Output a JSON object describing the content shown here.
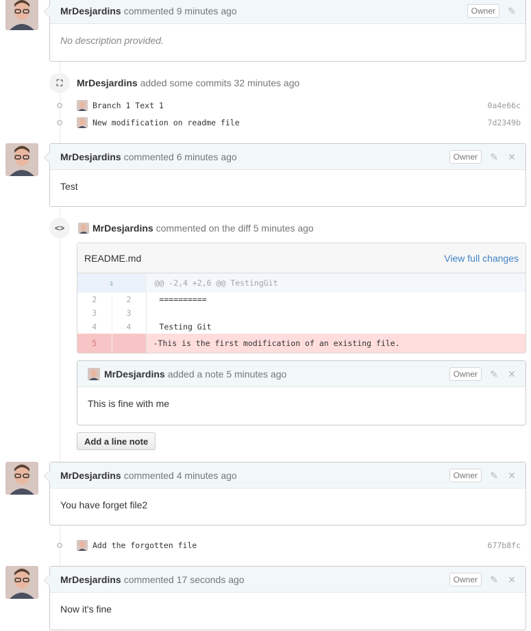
{
  "comments": [
    {
      "author": "MrDesjardins",
      "meta": "commented 9 minutes ago",
      "badge": "Owner",
      "body": "No description provided."
    },
    {
      "author": "MrDesjardins",
      "meta": "commented 6 minutes ago",
      "badge": "Owner",
      "body": "Test"
    },
    {
      "author": "MrDesjardins",
      "meta": "commented 4 minutes ago",
      "badge": "Owner",
      "body": "You have forget file2"
    },
    {
      "author": "MrDesjardins",
      "meta": "commented 17 seconds ago",
      "badge": "Owner",
      "body": "Now it's fine"
    }
  ],
  "commit_event": {
    "author": "MrDesjardins",
    "text": "added some commits 32 minutes ago"
  },
  "commits": [
    {
      "message": "Branch 1 Text 1",
      "sha": "0a4e66c"
    },
    {
      "message": "New modification on readme file",
      "sha": "7d2349b"
    },
    {
      "message": "Add the forgotten file",
      "sha": "677b8fc"
    }
  ],
  "diff_event": {
    "author": "MrDesjardins",
    "text": "commented on the diff 5 minutes ago"
  },
  "diff": {
    "filename": "README.md",
    "view_link": "View full changes",
    "hunk": "@@ -2,4 +2,6 @@ TestingGit",
    "lines": [
      {
        "old": "2",
        "new": "2",
        "code": " =========="
      },
      {
        "old": "3",
        "new": "3",
        "code": ""
      },
      {
        "old": "4",
        "new": "4",
        "code": " Testing Git"
      },
      {
        "old": "5",
        "new": "",
        "code": "-This is the first modification of an existing file."
      }
    ]
  },
  "note": {
    "author": "MrDesjardins",
    "meta": "added a note 5 minutes ago",
    "badge": "Owner",
    "body": "This is fine with me"
  },
  "add_line_note_label": "Add a line note",
  "icons": {
    "edit": "pencil-icon",
    "delete": "close-icon",
    "commit": "git-commit-icon",
    "diff": "code-icon"
  },
  "colors": {
    "header_bg": "#f2f8fa",
    "deletion_bg": "#ffdddd",
    "link": "#4183c4"
  }
}
